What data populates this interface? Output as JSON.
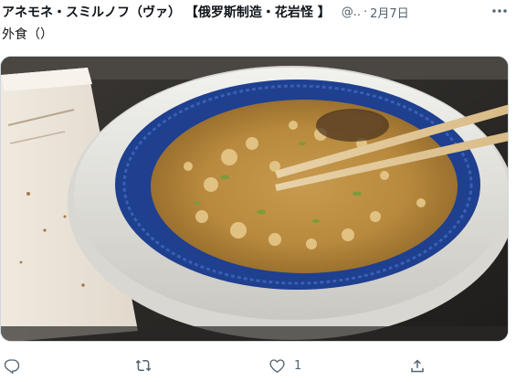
{
  "tweet": {
    "display_name": "アネモネ・スミルノフ（ヴァ） 【俄罗斯制造・花岩怪 】",
    "handle": "@..",
    "separator": "·",
    "date": "2月7日",
    "text": "外食（）"
  },
  "media": {
    "icon": "photo-noodle-soup"
  },
  "actions": {
    "reply": {
      "icon": "reply-icon"
    },
    "retweet": {
      "icon": "retweet-icon"
    },
    "like": {
      "icon": "heart-icon",
      "count": "1"
    },
    "share": {
      "icon": "share-icon"
    }
  },
  "colors": {
    "text": "#0f1419",
    "secondary": "#536471",
    "border": "#cfd9de"
  }
}
